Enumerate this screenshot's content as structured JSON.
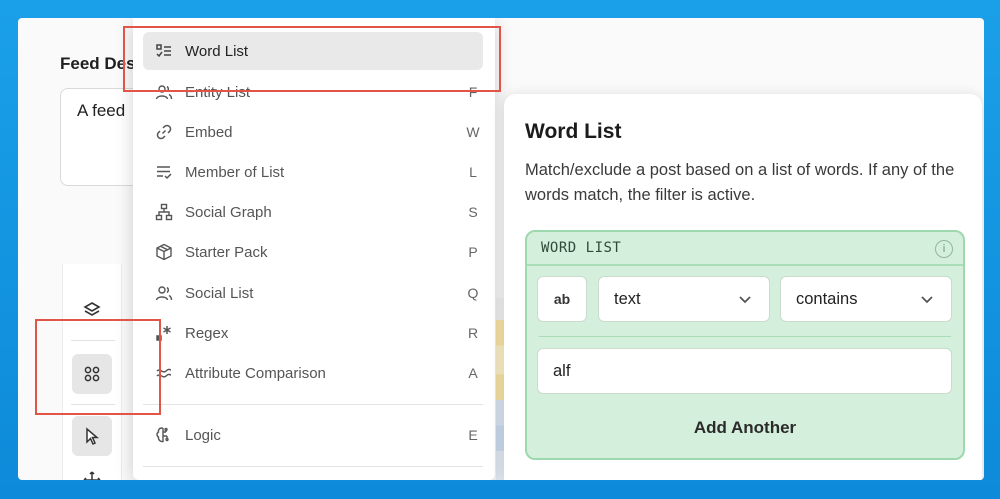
{
  "background": {
    "feed_label": "Feed Des",
    "feed_textarea_value": "A feed"
  },
  "toolbar": {
    "icons": [
      "layers-icon",
      "blocks-icon",
      "pointer-icon",
      "move-icon"
    ],
    "active_tool": "blocks"
  },
  "menu": {
    "items": [
      {
        "label": "Word List",
        "key": "",
        "icon": "word-list-icon"
      },
      {
        "label": "Entity List",
        "key": "F",
        "icon": "users-icon"
      },
      {
        "label": "Embed",
        "key": "W",
        "icon": "link-icon"
      },
      {
        "label": "Member of List",
        "key": "L",
        "icon": "list-check-icon"
      },
      {
        "label": "Social Graph",
        "key": "S",
        "icon": "network-icon"
      },
      {
        "label": "Starter Pack",
        "key": "P",
        "icon": "package-icon"
      },
      {
        "label": "Social List",
        "key": "Q",
        "icon": "users-icon"
      },
      {
        "label": "Regex",
        "key": "R",
        "icon": "regex-icon"
      },
      {
        "label": "Attribute Comparison",
        "key": "A",
        "icon": "approx-icon"
      },
      {
        "label": "Logic",
        "key": "E",
        "icon": "brain-icon"
      }
    ],
    "selected": "Word List"
  },
  "panel": {
    "title": "Word List",
    "description": "Match/exclude a post based on a list of words. If any of the words match, the filter is active.",
    "word_list": {
      "header": "WORD LIST",
      "type_badge": "ab",
      "field_select": "text",
      "operator_select": "contains",
      "word_value": "alf",
      "add_button": "Add Another"
    }
  },
  "colors": {
    "accent_highlight": "#e05547",
    "word_list_bg": "#d4f0dc",
    "word_list_border": "#9ed8ae",
    "page_bg": "#1aa0e8"
  }
}
